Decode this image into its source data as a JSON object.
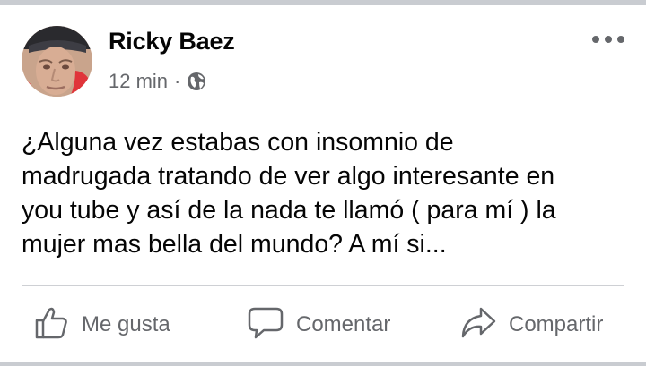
{
  "post": {
    "author": "Ricky Baez",
    "time": "12 min",
    "separator": "·",
    "visibility_icon": "globe-icon",
    "more_icon": "more-options-icon",
    "text": "¿Alguna vez estabas con insomnio de\nmadrugada tratando de ver algo interesante en\nyou tube y así de la nada te llamó ( para mí  ) la\nmujer mas bella del mundo? A mí si..."
  },
  "actions": {
    "like_label": "Me gusta",
    "like_icon": "thumbs-up-icon",
    "comment_label": "Comentar",
    "comment_icon": "speech-bubble-icon",
    "share_label": "Compartir",
    "share_icon": "share-arrow-icon"
  },
  "colors": {
    "text_primary": "#050505",
    "text_secondary": "#65676b",
    "divider": "#ced0d4",
    "feed_separator": "#c9ccd1"
  }
}
